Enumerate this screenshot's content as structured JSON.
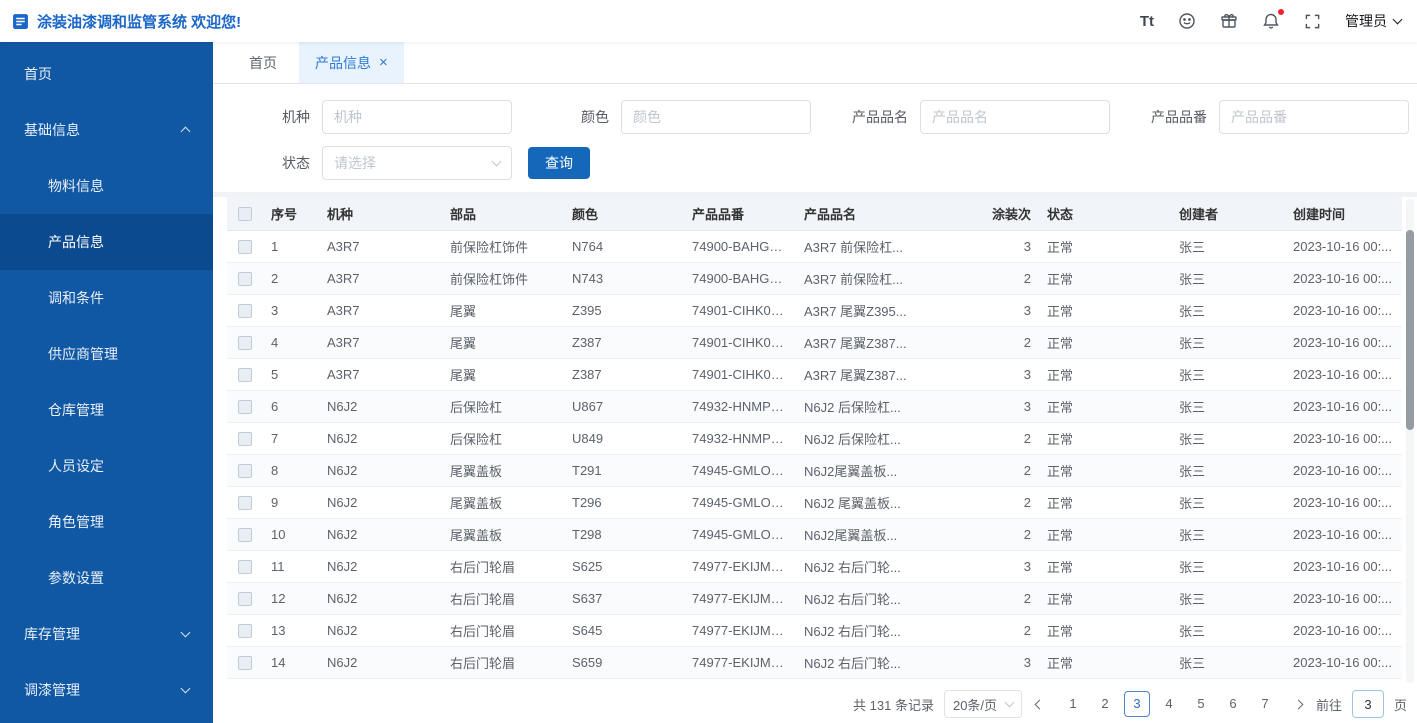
{
  "colors": {
    "sidebar_bg": "#1158A4",
    "sidebar_active_bg": "#0C4A8F",
    "primary_button": "#1568B9",
    "tab_active_bg": "#E8F3FE",
    "tab_active_text": "#2E7AD1",
    "header_title": "#1B66C9",
    "notification_badge": "#F5222D"
  },
  "header": {
    "title": "涂装油漆调和监管系统 欢迎您!",
    "font_icon_glyph": "Tt",
    "user_label": "管理员"
  },
  "sidebar": {
    "items": [
      {
        "label": "首页",
        "key": "home",
        "type": "item"
      },
      {
        "label": "基础信息",
        "key": "basic-info",
        "type": "group",
        "expanded": true,
        "active_child": "产品信息",
        "children": [
          {
            "label": "物料信息",
            "key": "material-info"
          },
          {
            "label": "产品信息",
            "key": "product-info"
          },
          {
            "label": "调和条件",
            "key": "mixing-conditions"
          },
          {
            "label": "供应商管理",
            "key": "supplier-management"
          },
          {
            "label": "仓库管理",
            "key": "warehouse-management"
          },
          {
            "label": "人员设定",
            "key": "personnel-settings"
          },
          {
            "label": "角色管理",
            "key": "role-management"
          },
          {
            "label": "参数设置",
            "key": "parameter-settings"
          }
        ]
      },
      {
        "label": "库存管理",
        "key": "inventory-management",
        "type": "group",
        "expanded": false
      },
      {
        "label": "调漆管理",
        "key": "paint-mixing-management",
        "type": "group",
        "expanded": false
      }
    ]
  },
  "tabs": [
    {
      "label": "首页",
      "key": "home",
      "active": false,
      "closable": false
    },
    {
      "label": "产品信息",
      "key": "product-info",
      "active": true,
      "closable": true
    }
  ],
  "search": {
    "fields": [
      {
        "label": "机种",
        "placeholder": "机种"
      },
      {
        "label": "颜色",
        "placeholder": "颜色"
      },
      {
        "label": "产品品名",
        "placeholder": "产品品名"
      },
      {
        "label": "产品品番",
        "placeholder": "产品品番"
      },
      {
        "label": "状态",
        "placeholder": "请选择"
      }
    ],
    "query_label": "查询"
  },
  "table": {
    "columns": [
      {
        "key": "index",
        "label": "序号"
      },
      {
        "key": "machine-type",
        "label": "机种"
      },
      {
        "key": "part",
        "label": "部品"
      },
      {
        "key": "color",
        "label": "颜色"
      },
      {
        "key": "product-no",
        "label": "产品品番"
      },
      {
        "key": "product-name",
        "label": "产品品名"
      },
      {
        "key": "coating-count",
        "label": "涂装次"
      },
      {
        "key": "status",
        "label": "状态"
      },
      {
        "key": "creator",
        "label": "创建者"
      },
      {
        "key": "created-time",
        "label": "创建时间"
      }
    ],
    "rows": [
      [
        "1",
        "A3R7",
        "前保险杠饰件",
        "N764",
        "74900-BAHG00...",
        "A3R7 前保险杠...",
        "3",
        "正常",
        "张三",
        "2023-10-16 00:..."
      ],
      [
        "2",
        "A3R7",
        "前保险杠饰件",
        "N743",
        "74900-BAHG00...",
        "A3R7 前保险杠...",
        "2",
        "正常",
        "张三",
        "2023-10-16 00:..."
      ],
      [
        "3",
        "A3R7",
        "尾翼",
        "Z395",
        "74901-CIHK00...",
        "A3R7 尾翼Z395...",
        "3",
        "正常",
        "张三",
        "2023-10-16 00:..."
      ],
      [
        "4",
        "A3R7",
        "尾翼",
        "Z387",
        "74901-CIHK00...",
        "A3R7 尾翼Z387...",
        "2",
        "正常",
        "张三",
        "2023-10-16 00:..."
      ],
      [
        "5",
        "A3R7",
        "尾翼",
        "Z387",
        "74901-CIHK00...",
        "A3R7 尾翼Z387...",
        "3",
        "正常",
        "张三",
        "2023-10-16 00:..."
      ],
      [
        "6",
        "N6J2",
        "后保险杠",
        "U867",
        "74932-HNMP0...",
        "N6J2 后保险杠...",
        "3",
        "正常",
        "张三",
        "2023-10-16 00:..."
      ],
      [
        "7",
        "N6J2",
        "后保险杠",
        "U849",
        "74932-HNMP0...",
        "N6J2 后保险杠...",
        "2",
        "正常",
        "张三",
        "2023-10-16 00:..."
      ],
      [
        "8",
        "N6J2",
        "尾翼盖板",
        "T291",
        "74945-GMLO0...",
        "N6J2尾翼盖板...",
        "2",
        "正常",
        "张三",
        "2023-10-16 00:..."
      ],
      [
        "9",
        "N6J2",
        "尾翼盖板",
        "T296",
        "74945-GMLO0...",
        "N6J2 尾翼盖板...",
        "2",
        "正常",
        "张三",
        "2023-10-16 00:..."
      ],
      [
        "10",
        "N6J2",
        "尾翼盖板",
        "T298",
        "74945-GMLO0...",
        "N6J2尾翼盖板...",
        "2",
        "正常",
        "张三",
        "2023-10-16 00:..."
      ],
      [
        "11",
        "N6J2",
        "右后门轮眉",
        "S625",
        "74977-EKIJM0...",
        "N6J2 右后门轮...",
        "3",
        "正常",
        "张三",
        "2023-10-16 00:..."
      ],
      [
        "12",
        "N6J2",
        "右后门轮眉",
        "S637",
        "74977-EKIJM0...",
        "N6J2 右后门轮...",
        "2",
        "正常",
        "张三",
        "2023-10-16 00:..."
      ],
      [
        "13",
        "N6J2",
        "右后门轮眉",
        "S645",
        "74977-EKIJM0...",
        "N6J2 右后门轮...",
        "2",
        "正常",
        "张三",
        "2023-10-16 00:..."
      ],
      [
        "14",
        "N6J2",
        "右后门轮眉",
        "S659",
        "74977-EKIJM0...",
        "N6J2 右后门轮...",
        "3",
        "正常",
        "张三",
        "2023-10-16 00:..."
      ]
    ]
  },
  "pagination": {
    "total_text": "共 131 条记录",
    "page_size_label": "20条/页",
    "pages": [
      "1",
      "2",
      "3",
      "4",
      "5",
      "6",
      "7"
    ],
    "current_page": "3",
    "goto_label": "前往",
    "goto_value": "3",
    "page_unit": "页"
  }
}
